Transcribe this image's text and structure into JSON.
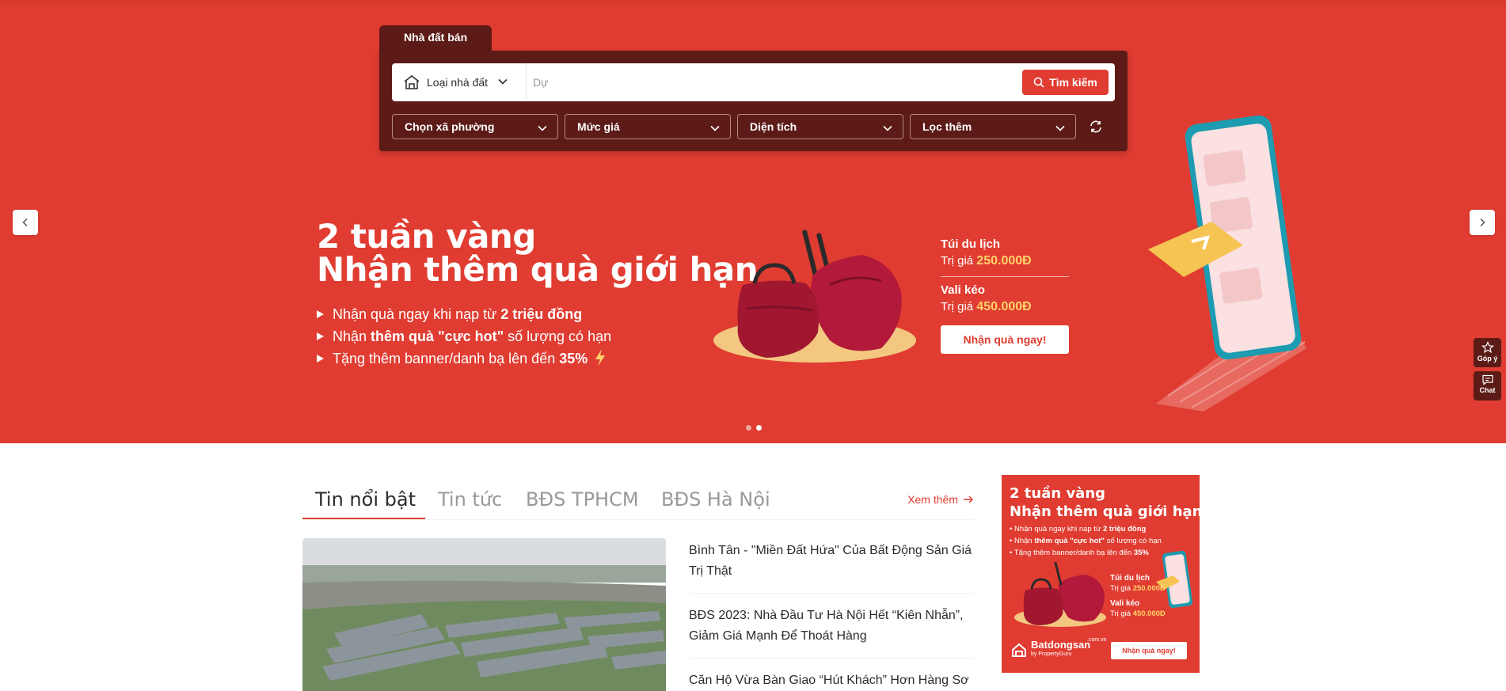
{
  "search": {
    "tab_label": "Nhà đất bán",
    "property_type": "Loại nhà đất",
    "placeholder": "Dự",
    "submit_label": "Tìm kiếm",
    "filters": [
      "Chọn xã phường",
      "Mức giá",
      "Diện tích",
      "Lọc thêm"
    ]
  },
  "banner": {
    "title_line1": "2 tuần vàng",
    "title_line2": "Nhận thêm quà giới hạn",
    "bullet1_pre": "Nhận quà ngay khi nạp từ ",
    "bullet1_bold": "2 triệu đồng",
    "bullet2_pre": "Nhận ",
    "bullet2_bold": "thêm quà \"cực hot\"",
    "bullet2_post": " số lượng có hạn",
    "bullet3_pre": "Tặng thêm banner/danh bạ lên đến ",
    "bullet3_bold": "35%",
    "gift1_name": "Túi du lịch",
    "gift1_price_label": "Trị giá ",
    "gift1_price": "250.000Đ",
    "gift2_name": "Vali kéo",
    "gift2_price_label": "Trị giá ",
    "gift2_price": "450.000Đ",
    "cta": "Nhận quà ngay!",
    "active_slide": 2,
    "slide_count": 2
  },
  "side_buttons": {
    "feedback": "Góp ý",
    "chat": "Chat"
  },
  "news": {
    "tabs": [
      "Tin nổi bật",
      "Tin tức",
      "BĐS TPHCM",
      "BĐS Hà Nội"
    ],
    "active_tab": 0,
    "see_more": "Xem thêm",
    "items": [
      "Bình Tân - \"Miền Đất Hứa\" Của Bất Động Sản Giá Trị Thật",
      "BĐS 2023: Nhà Đầu Tư Hà Nội Hết “Kiên Nhẫn”, Giảm Giá Mạnh Để Thoát Hàng",
      "Căn Hộ Vừa Bàn Giao “Hút Khách” Hơn Hàng Sơ"
    ]
  },
  "ad": {
    "title_line1": "2 tuần vàng",
    "title_line2": "Nhận thêm quà giới hạn",
    "bullet1_pre": "• Nhận quà ngay khi nạp từ ",
    "bullet1_bold": "2 triệu đồng",
    "bullet2_pre": "• Nhận ",
    "bullet2_bold": "thêm quà \"cực hot\"",
    "bullet2_post": " số lượng có hạn",
    "bullet3_pre": "• Tặng thêm banner/danh bạ lên đến ",
    "bullet3_bold": "35%",
    "gift1_name": "Túi du lịch",
    "gift1_price_label": "Trị giá ",
    "gift1_price": "250.000Đ",
    "gift2_name": "Vali kéo",
    "gift2_price_label": "Trị giá ",
    "gift2_price": "450.000Đ",
    "brand": "Batdongsan",
    "brand_sub": "by PropertyGuru",
    "brand_domain": ".com.vn",
    "cta": "Nhận quà ngay!"
  },
  "colors": {
    "brand_red": "#e03c31",
    "panel_dark": "#5c1b17",
    "highlight_gold": "#ffd36b"
  }
}
